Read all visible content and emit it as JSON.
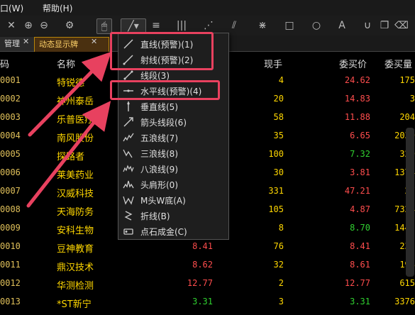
{
  "menubar": {
    "item1": "口(W)",
    "item2": "帮助(H)"
  },
  "tabs": {
    "tab1": "管理",
    "tab2": "动态显示牌"
  },
  "table": {
    "headers": {
      "code": "码",
      "name": "名称",
      "volume": "现手",
      "bid_price": "委买价",
      "bid_volume": "委买量"
    },
    "rows": [
      {
        "code": "0001",
        "name": "特锐德",
        "price": "",
        "volume": "4",
        "bid": "24.62",
        "bidv": "175",
        "pc": "red"
      },
      {
        "code": "0002",
        "name": "神州泰岳",
        "price": "",
        "volume": "20",
        "bid": "14.83",
        "bidv": "3",
        "pc": "red"
      },
      {
        "code": "0003",
        "name": "乐普医疗",
        "price": "",
        "volume": "58",
        "bid": "11.88",
        "bidv": "204",
        "pc": "red"
      },
      {
        "code": "0004",
        "name": "南风股份",
        "price": "",
        "volume": "35",
        "bid": "6.65",
        "bidv": "2039",
        "pc": "red"
      },
      {
        "code": "0005",
        "name": "探路者",
        "price": "",
        "volume": "100",
        "bid": "7.32",
        "bidv": "329",
        "pc": "green"
      },
      {
        "code": "0006",
        "name": "莱美药业",
        "price": "",
        "volume": "30",
        "bid": "3.81",
        "bidv": "1374",
        "pc": "red"
      },
      {
        "code": "0007",
        "name": "汉威科技",
        "price": "",
        "volume": "331",
        "bid": "47.21",
        "bidv": "27",
        "pc": "red"
      },
      {
        "code": "0008",
        "name": "天海防务",
        "price": "",
        "volume": "105",
        "bid": "4.87",
        "bidv": "7324",
        "pc": "red"
      },
      {
        "code": "0009",
        "name": "安科生物",
        "price": "",
        "volume": "8",
        "bid": "8.70",
        "bidv": "1442",
        "pc": "green"
      },
      {
        "code": "0010",
        "name": "豆神教育",
        "price": "8.41",
        "volume": "76",
        "bid": "8.41",
        "bidv": "235",
        "pc": "red"
      },
      {
        "code": "0011",
        "name": "鼎汉技术",
        "price": "8.62",
        "volume": "32",
        "bid": "8.61",
        "bidv": "198",
        "pc": "red"
      },
      {
        "code": "0012",
        "name": "华测检测",
        "price": "12.77",
        "volume": "2",
        "bid": "12.77",
        "bidv": "615",
        "pc": "red"
      },
      {
        "code": "0013",
        "name": "*ST新宁",
        "price": "3.31",
        "volume": "3",
        "bid": "3.31",
        "bidv": "3376",
        "pc": "green"
      }
    ]
  },
  "menu": {
    "items": [
      {
        "label": "直线(预警)(1)",
        "icon": "straight-line-icon"
      },
      {
        "label": "射线(预警)(2)",
        "icon": "ray-line-icon"
      },
      {
        "label": "线段(3)",
        "icon": "segment-line-icon"
      },
      {
        "label": "水平线(预警)(4)",
        "icon": "horizontal-line-icon"
      },
      {
        "label": "垂直线(5)",
        "icon": "vertical-line-icon"
      },
      {
        "label": "箭头线段(6)",
        "icon": "arrow-segment-icon"
      },
      {
        "label": "五浪线(7)",
        "icon": "five-wave-icon"
      },
      {
        "label": "三浪线(8)",
        "icon": "three-wave-icon"
      },
      {
        "label": "八浪线(9)",
        "icon": "eight-wave-icon"
      },
      {
        "label": "头肩形(0)",
        "icon": "head-shoulders-icon"
      },
      {
        "label": "M头W底(A)",
        "icon": "m-top-w-bottom-icon"
      },
      {
        "label": "折线(B)",
        "icon": "polyline-icon"
      },
      {
        "label": "点石成金(C)",
        "icon": "magic-gold-icon"
      }
    ]
  },
  "colors": {
    "highlight": "#e8415f",
    "up": "#ff4d4d",
    "down": "#30d030",
    "name": "#ffd700"
  }
}
